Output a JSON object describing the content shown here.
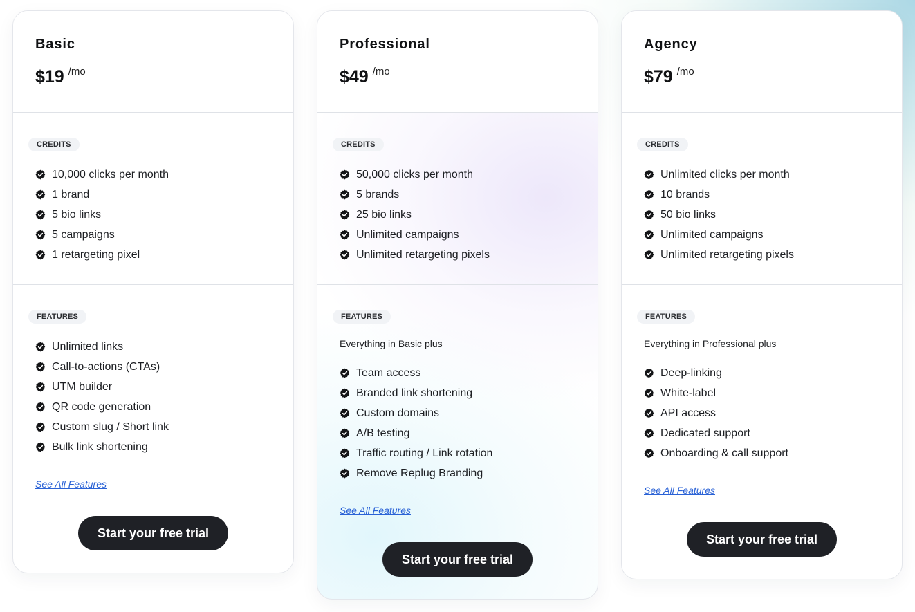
{
  "plans": [
    {
      "name": "Basic",
      "price": "$19",
      "period": "/mo",
      "credits_label": "CREDITS",
      "credits": [
        "10,000 clicks per month",
        "1 brand",
        "5 bio links",
        "5 campaigns",
        "1 retargeting pixel"
      ],
      "features_label": "FEATURES",
      "features_subtitle": "",
      "features": [
        "Unlimited links",
        "Call-to-actions (CTAs)",
        "UTM builder",
        "QR code generation",
        "Custom slug / Short link",
        "Bulk link shortening"
      ],
      "see_all": "See All Features",
      "cta": "Start your free trial"
    },
    {
      "name": "Professional",
      "price": "$49",
      "period": "/mo",
      "credits_label": "CREDITS",
      "credits": [
        "50,000 clicks per month",
        "5 brands",
        "25 bio links",
        "Unlimited campaigns",
        "Unlimited retargeting pixels"
      ],
      "features_label": "FEATURES",
      "features_subtitle": "Everything in Basic plus",
      "features": [
        "Team access",
        "Branded link shortening",
        "Custom domains",
        "A/B testing",
        "Traffic routing / Link rotation",
        "Remove Replug Branding"
      ],
      "see_all": "See All Features",
      "cta": "Start your free trial"
    },
    {
      "name": "Agency",
      "price": "$79",
      "period": "/mo",
      "credits_label": "CREDITS",
      "credits": [
        "Unlimited clicks per month",
        "10 brands",
        "50 bio links",
        "Unlimited campaigns",
        "Unlimited retargeting pixels"
      ],
      "features_label": "FEATURES",
      "features_subtitle": "Everything in Professional plus",
      "features": [
        "Deep-linking",
        "White-label",
        "API access",
        "Dedicated support",
        "Onboarding & call support"
      ],
      "see_all": "See All Features",
      "cta": "Start your free trial"
    }
  ],
  "colors": {
    "button_bg": "#1f2126",
    "link": "#2a62d6",
    "pill_bg": "#f1f3f6"
  }
}
